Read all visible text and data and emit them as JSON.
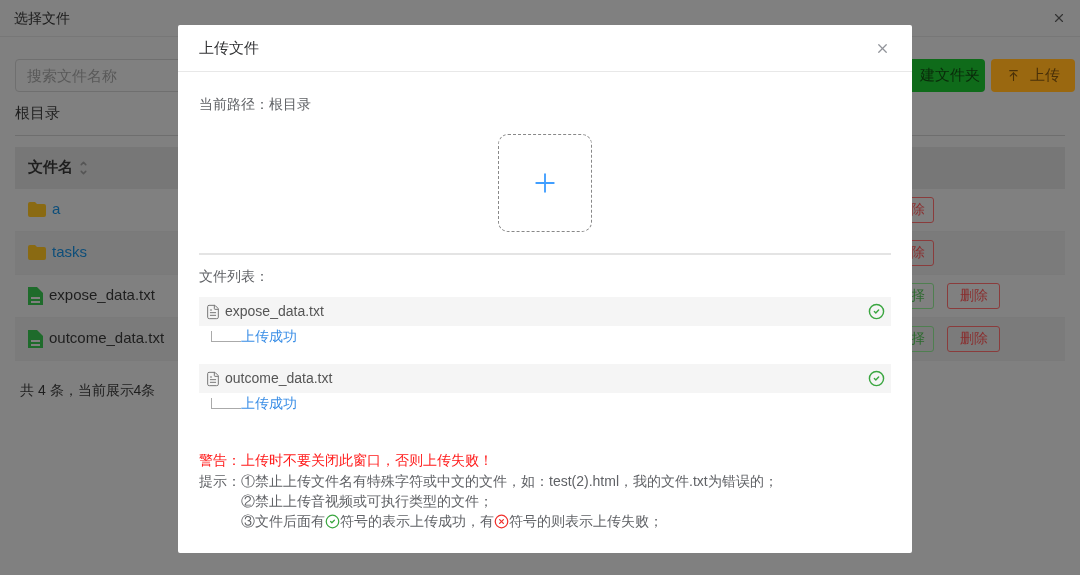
{
  "background": {
    "title": "选择文件",
    "search": {
      "placeholder": "搜索文件名称"
    },
    "breadcrumb": "根目录",
    "buttons": [
      {
        "label": "建文件夹",
        "kind": "folder"
      },
      {
        "label": "上传",
        "kind": "upload"
      }
    ],
    "table": {
      "columns": [
        "文件名"
      ],
      "rows": [
        {
          "name": "a",
          "kind": "folder",
          "actions": [
            {
              "label": "除",
              "kind": "delete"
            }
          ]
        },
        {
          "name": "tasks",
          "kind": "folder",
          "actions": [
            {
              "label": "除",
              "kind": "delete"
            }
          ]
        },
        {
          "name": "expose_data.txt",
          "kind": "file",
          "actions": [
            {
              "label": "择",
              "kind": "select"
            },
            {
              "label": "删除",
              "kind": "delete"
            }
          ]
        },
        {
          "name": "outcome_data.txt",
          "kind": "file",
          "actions": [
            {
              "label": "择",
              "kind": "select"
            },
            {
              "label": "删除",
              "kind": "delete"
            }
          ]
        }
      ]
    },
    "footer": "共 4 条，当前展示4条"
  },
  "dialog": {
    "title": "上传文件",
    "path_label": "当前路径：",
    "path": "根目录",
    "file_list_label": "文件列表：",
    "files": [
      {
        "name": "expose_data.txt",
        "uploaded": true,
        "message": "上传成功"
      },
      {
        "name": "outcome_data.txt",
        "uploaded": true,
        "message": "上传成功"
      }
    ],
    "warning": "警告：上传时不要关闭此窗口，否则上传失败！",
    "tips_label": "提示：",
    "tips": [
      {
        "parts": [
          {
            "kind": "text",
            "text": "①禁止上传文件名有特殊字符或中文的文件，如：test(2).html，我的文件.txt为错误的；"
          }
        ]
      },
      {
        "parts": [
          {
            "kind": "text",
            "text": "②禁止上传音视频或可执行类型的文件；"
          }
        ]
      },
      {
        "parts": [
          {
            "kind": "text",
            "text": "③文件后面有"
          },
          {
            "kind": "success_icon"
          },
          {
            "kind": "text",
            "text": "符号的表示上传成功，有"
          },
          {
            "kind": "fail_icon"
          },
          {
            "kind": "text",
            "text": "符号的则表示上传失败；"
          }
        ]
      }
    ]
  }
}
